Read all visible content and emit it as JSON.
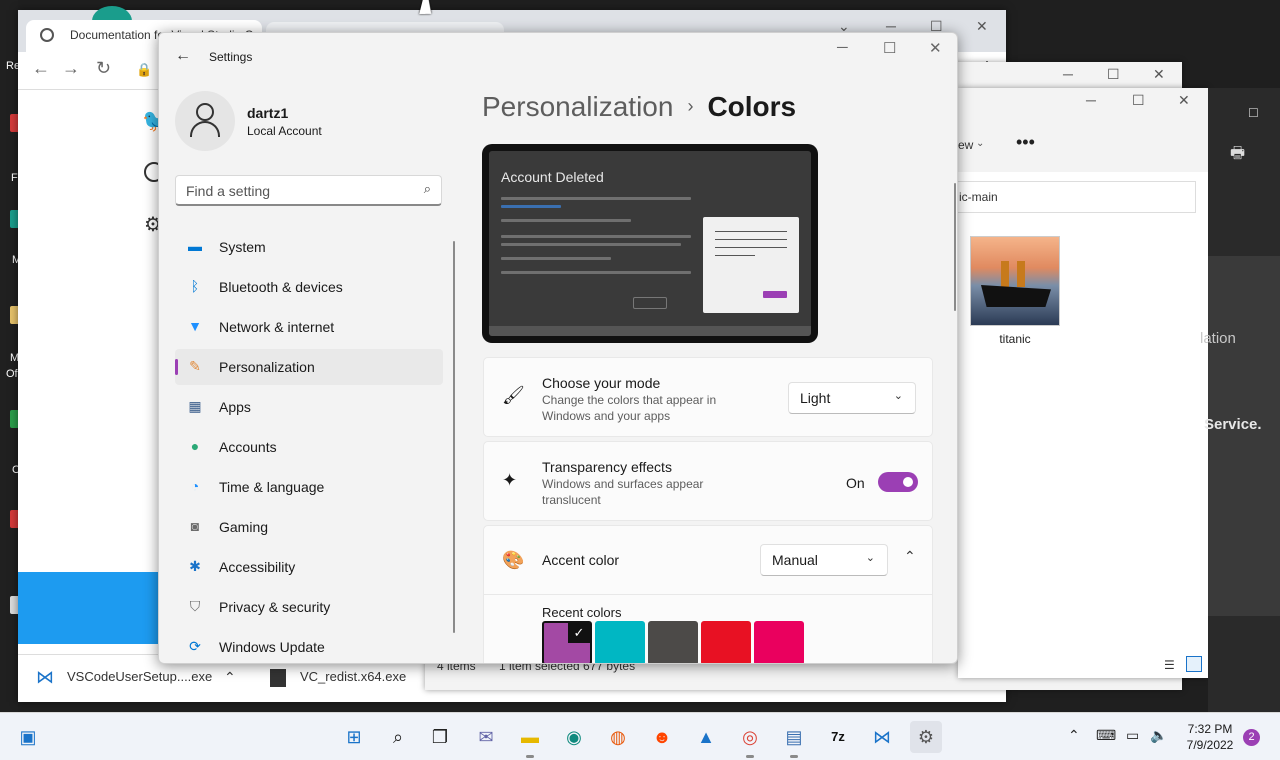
{
  "desktop": {
    "fragments": [
      "Re",
      "F",
      "M",
      "M",
      "Of",
      "C"
    ]
  },
  "browser": {
    "tab_title": "Documentation for Visual Studio Code",
    "downloads": [
      {
        "name": "VSCodeUserSetup....exe"
      },
      {
        "name": "VC_redist.x64.exe"
      }
    ]
  },
  "explorer2": {
    "status_items": "4 items",
    "status_selected": "1 item selected  677 bytes",
    "view_label": "ew"
  },
  "explorer": {
    "address": "ic-main",
    "file_name": "titanic"
  },
  "right_panel": {
    "text1": "lation",
    "text2": "Service."
  },
  "settings": {
    "window_title": "Settings",
    "user": {
      "name": "dartz1",
      "account_type": "Local Account"
    },
    "search": {
      "placeholder": "Find a setting"
    },
    "nav": [
      {
        "label": "System",
        "icon": "monitor-icon",
        "color": "#0078d4"
      },
      {
        "label": "Bluetooth & devices",
        "icon": "bluetooth-icon",
        "color": "#0078d4"
      },
      {
        "label": "Network & internet",
        "icon": "wifi-icon",
        "color": "#1e90ff"
      },
      {
        "label": "Personalization",
        "icon": "brush-icon",
        "color": "#e08a3a"
      },
      {
        "label": "Apps",
        "icon": "apps-icon",
        "color": "#3a5d8a"
      },
      {
        "label": "Accounts",
        "icon": "person-icon",
        "color": "#2aa876"
      },
      {
        "label": "Time & language",
        "icon": "globe-clock-icon",
        "color": "#1e90ff"
      },
      {
        "label": "Gaming",
        "icon": "gamepad-icon",
        "color": "#6b6b6b"
      },
      {
        "label": "Accessibility",
        "icon": "accessibility-icon",
        "color": "#1a73c9"
      },
      {
        "label": "Privacy & security",
        "icon": "shield-icon",
        "color": "#6b6b6b"
      },
      {
        "label": "Windows Update",
        "icon": "update-icon",
        "color": "#0078d4"
      }
    ],
    "breadcrumb": {
      "parent": "Personalization",
      "separator": "›",
      "current": "Colors"
    },
    "preview": {
      "title": "Account Deleted"
    },
    "mode": {
      "title": "Choose your mode",
      "subtitle": "Change the colors that appear in Windows and your apps",
      "value": "Light"
    },
    "transparency": {
      "title": "Transparency effects",
      "subtitle": "Windows and surfaces appear translucent",
      "state": "On"
    },
    "accent": {
      "title": "Accent color",
      "value": "Manual",
      "recent_label": "Recent colors",
      "recent_colors": [
        "#a349a4",
        "#00b7c3",
        "#4c4a48",
        "#e81123",
        "#ea005e"
      ]
    },
    "accent_color": "#9b3fb4"
  },
  "taskbar": {
    "time": "7:32 PM",
    "date": "7/9/2022",
    "notifications": "2"
  }
}
